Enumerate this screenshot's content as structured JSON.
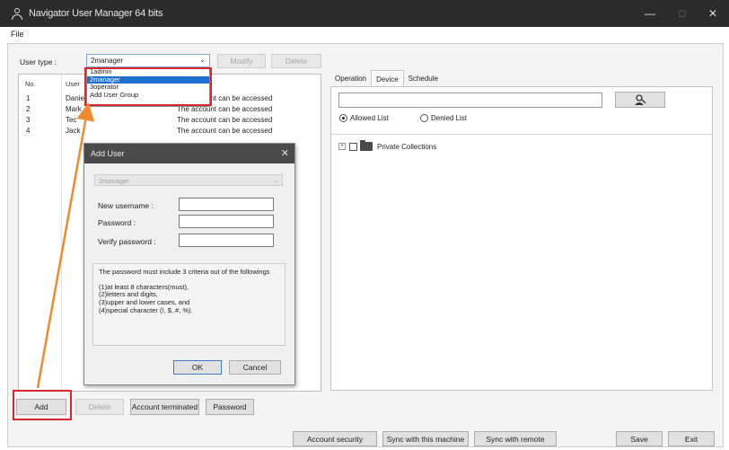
{
  "window": {
    "title": "Navigator User Manager 64 bits",
    "minimize_glyph": "—",
    "maximize_glyph": "□",
    "close_glyph": "✕"
  },
  "menu": {
    "file": "File"
  },
  "user_type": {
    "label": "User type :",
    "selected": "2manager",
    "modify_label": "Modify",
    "delete_label": "Delete",
    "options": [
      "1admin",
      "2manager",
      "3operator",
      "Add User Group"
    ]
  },
  "user_list": {
    "columns": [
      "No.",
      "User"
    ],
    "rows": [
      {
        "no": "1",
        "name": "Daniel",
        "status": "The account can be accessed"
      },
      {
        "no": "2",
        "name": "Mark",
        "status": "The account can be accessed"
      },
      {
        "no": "3",
        "name": "Tec",
        "status": "The account can be accessed"
      },
      {
        "no": "4",
        "name": "Jack",
        "status": "The account can be accessed"
      }
    ]
  },
  "right_panel": {
    "tabs": [
      "Operation",
      "Device",
      "Schedule"
    ],
    "active_tab": "Device",
    "allowed_list_label": "Allowed List",
    "denied_list_label": "Denied List",
    "tree_item": "Private Collections",
    "expander_glyph": "+"
  },
  "dialog": {
    "title": "Add User",
    "close_glyph": "✕",
    "group_select": "2manager",
    "new_username_label": "New username :",
    "password_label": "Password :",
    "verify_password_label": "Verify password :",
    "info_intro": "The password must include 3 criteria out of the followings",
    "info_items": [
      "(1)at least 8 characters(must),",
      "(2)letters and digits,",
      "(3)upper and lower cases, and",
      "(4)special character (!, $, #, %)."
    ],
    "ok_label": "OK",
    "cancel_label": "Cancel"
  },
  "bottom": {
    "add_label": "Add",
    "delete_label": "Delete",
    "account_terminated_label": "Account terminated",
    "password_label": "Password",
    "account_security_label": "Account security",
    "sync_machine_label": "Sync with this machine",
    "sync_remote_label": "Sync with remote",
    "save_label": "Save",
    "exit_label": "Exit"
  },
  "icons": {
    "app": "user-icon",
    "search": "user-search-icon",
    "tree_node": "folder-icon",
    "dropdown": "chevron-down-icon"
  },
  "colors": {
    "title_bar": "#2b2b2b",
    "selection": "#1e6fd0",
    "highlight_box": "#d9272e",
    "annotation_arrow": "#f08a2c"
  }
}
